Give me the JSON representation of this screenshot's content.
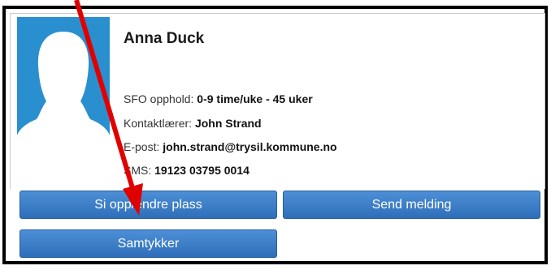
{
  "student": {
    "name": "Anna Duck"
  },
  "details": {
    "stay_label": "SFO opphold:",
    "stay_value": "0-9 time/uke - 45 uker",
    "teacher_label": "Kontaktlærer:",
    "teacher_value": "John Strand",
    "email_label": "E-post:",
    "email_value": "john.strand@trysil.kommune.no",
    "sms_label": "SMS:",
    "sms_value": "19123 03795 0014"
  },
  "actions": {
    "cancel_change": "Si opp/endre plass",
    "send_message": "Send melding",
    "consent": "Samtykker"
  },
  "colors": {
    "accent": "#2f6fba",
    "annotation": "#e10000",
    "avatar_bg": "#2a8fcf"
  },
  "icons": {
    "avatar": "person-silhouette-icon",
    "annotation": "red-arrow-icon"
  }
}
